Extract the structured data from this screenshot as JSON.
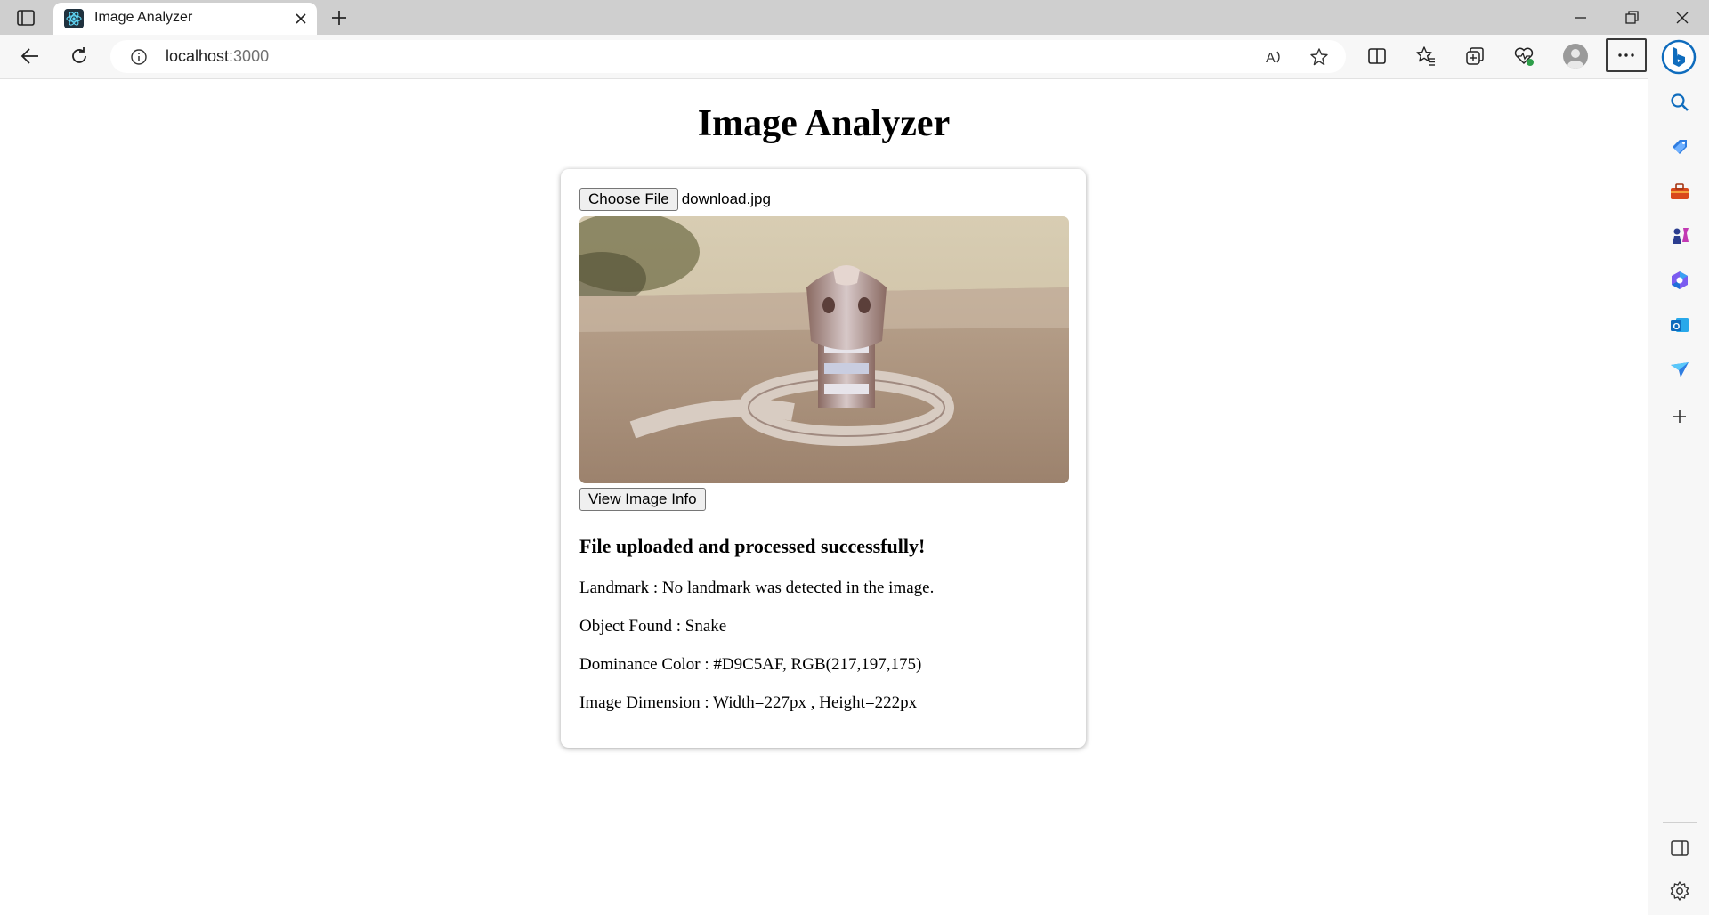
{
  "browser": {
    "tab": {
      "title": "Image Analyzer"
    },
    "address": {
      "host": "localhost",
      "port": ":3000"
    }
  },
  "page": {
    "title": "Image Analyzer",
    "file_input": {
      "button_label": "Choose File",
      "file_name": "download.jpg"
    },
    "view_info_button": "View Image Info",
    "status_message": "File uploaded and processed successfully!",
    "results": [
      {
        "label": "Landmark",
        "value": "No landmark was detected in the image."
      },
      {
        "label": "Object Found",
        "value": "Snake"
      },
      {
        "label": "Dominance Color",
        "value": "#D9C5AF, RGB(217,197,175)"
      },
      {
        "label": "Image Dimension",
        "value": "Width=227px , Height=222px"
      }
    ]
  },
  "icons": {
    "tab_actions": "tab-actions-icon",
    "new_tab": "plus-icon",
    "back": "arrow-left-icon",
    "reload": "reload-icon",
    "info": "info-icon",
    "read_aloud": "read-aloud-icon",
    "favorite": "star-icon",
    "split_screen": "split-screen-icon",
    "favorites": "favorites-icon",
    "collections": "collections-icon",
    "health": "browser-essentials-icon",
    "profile": "avatar",
    "more": "more-icon",
    "copilot": "copilot-icon",
    "sidebar": [
      "search-icon",
      "shopping-icon",
      "tools-icon",
      "games-icon",
      "microsoft365-icon",
      "outlook-icon",
      "drop-icon",
      "add-icon",
      "sidebar-toggle-icon",
      "settings-icon"
    ]
  },
  "colors": {
    "dominant": "#D9C5AF",
    "tabstrip": "#CFCFCF",
    "accent": "#0F6CBD"
  }
}
